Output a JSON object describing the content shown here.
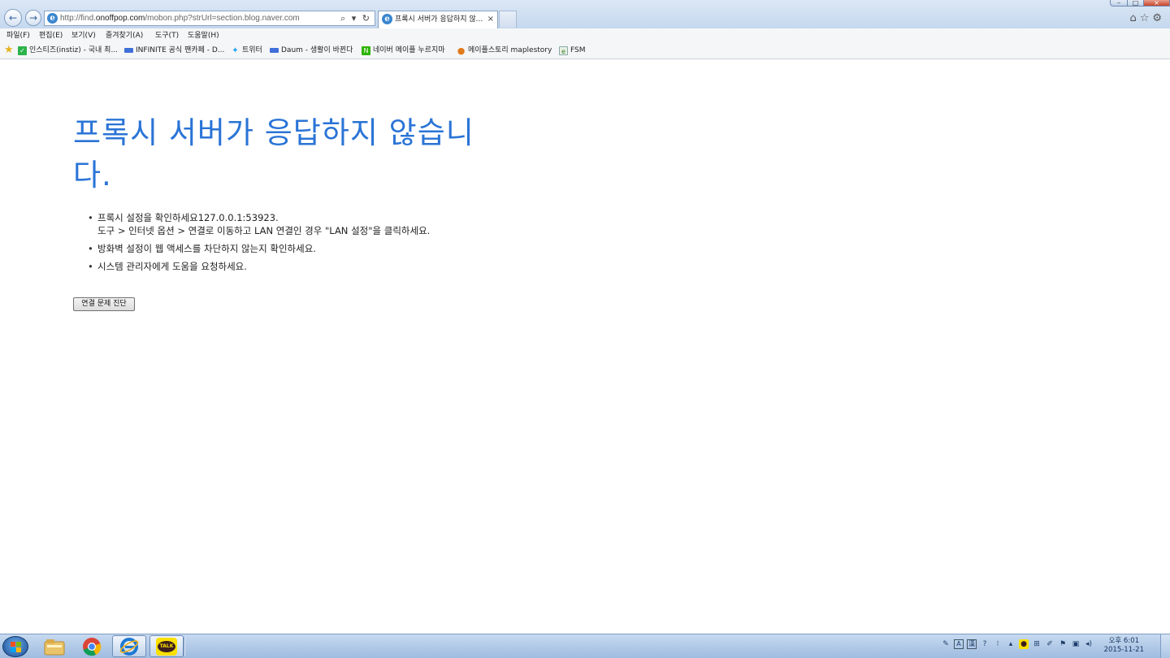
{
  "browser": {
    "url_prefix": "http://find.",
    "url_host": "onoffpop.com",
    "url_suffix": "/mobon.php?strUrl=section.blog.naver.com",
    "address_icons": "⌕ ▾ ↻",
    "tab_title": "프록시 서버가 응답하지 않...",
    "tab_close": "×",
    "right_icons": "⌂☆⚙"
  },
  "menu": [
    "파일(F)",
    "편집(E)",
    "보기(V)",
    "즐겨찾기(A)",
    "도구(T)",
    "도움말(H)"
  ],
  "favorites": [
    {
      "label": "인스티즈(instiz) - 국내 최...",
      "icon_color": "#2bb34a",
      "icon": "✓"
    },
    {
      "label": "INFINITE 공식 팬카페 - D...",
      "icon_color": "#3f6fd8",
      "icon": ""
    },
    {
      "label": "트위터",
      "icon_color": "#1da1f2",
      "icon": "✦"
    },
    {
      "label": "Daum - 생활이 바뀐다",
      "icon_color": "#3f6fd8",
      "icon": ""
    },
    {
      "label": "네이버 메이플 누르지마",
      "icon_color": "#2db400",
      "icon": "N"
    },
    {
      "label": "메이플스토리  maplestory",
      "icon_color": "#e07b1d",
      "icon": "●"
    },
    {
      "label": "FSM",
      "icon_color": "#6aa06a",
      "icon": "e"
    }
  ],
  "page": {
    "title": "프록시 서버가 응답하지 않습니다.",
    "items": [
      {
        "line1": "프록시 설정을 확인하세요127.0.0.1:53923.",
        "line2": "도구 > 인터넷 옵션 > 연결로 이동하고 LAN 연결인 경우 \"LAN 설정\"을 클릭하세요."
      },
      {
        "line1": "방화벽 설정이 웹 액세스를 차단하지 않는지 확인하세요.",
        "line2": ""
      },
      {
        "line1": "시스템 관리자에게 도움을 요청하세요.",
        "line2": ""
      }
    ],
    "diagnose_button": "연결 문제 진단"
  },
  "taskbar": {
    "kakao_label": "TALK",
    "clock_period_time": "오후 6:01",
    "clock_date": "2015-11-21"
  },
  "colors": {
    "title_blue": "#2a74d6",
    "accent_ie": "#3a86cf"
  }
}
